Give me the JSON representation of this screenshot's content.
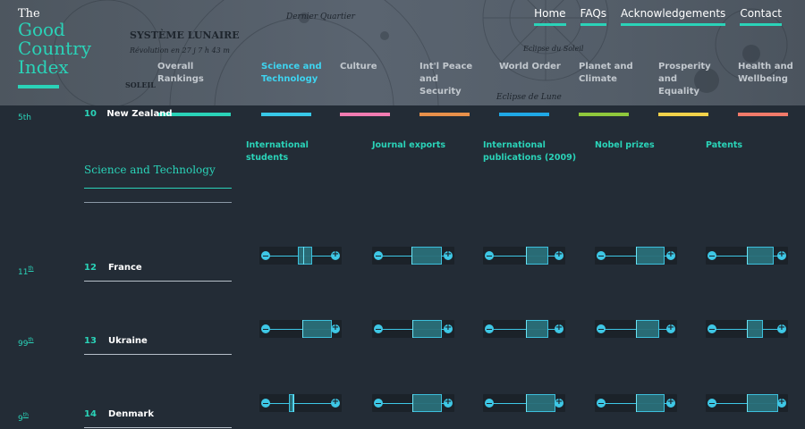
{
  "logo": {
    "small": "The",
    "line1": "Good",
    "line2": "Country",
    "line3": "Index"
  },
  "top_nav": [
    "Home",
    "FAQs",
    "Acknowledgements",
    "Contact"
  ],
  "header_art_text": [
    "SYSTÈME LUNAIRE",
    "Dernier Quartier",
    "Révolution en 27 j 7 h 43 m",
    "SOLEIL",
    "Eclipse du Soleil",
    "Eclipse de Lune"
  ],
  "tabs": [
    {
      "label": "Overall Rankings",
      "color": "#2ad3b8",
      "active": false
    },
    {
      "label": "Science and Technology",
      "color": "#38c8e8",
      "active": true
    },
    {
      "label": "Culture",
      "color": "#f27bb1",
      "active": false
    },
    {
      "label": "Int'l Peace and Security",
      "color": "#e8904a",
      "active": false
    },
    {
      "label": "World Order",
      "color": "#1fa8e6",
      "active": false
    },
    {
      "label": "Planet and Climate",
      "color": "#8fc83c",
      "active": false
    },
    {
      "label": "Prosperity and Equality",
      "color": "#f2d24a",
      "active": false
    },
    {
      "label": "Health and Wellbeing",
      "color": "#f27a6a",
      "active": false
    }
  ],
  "peek_row": {
    "rank": "5th",
    "num": "10",
    "name": "New Zealand"
  },
  "section_title": "Science and Technology",
  "categories": [
    "International students",
    "Journal exports",
    "International publications (2009)",
    "Nobel prizes",
    "Patents"
  ],
  "rows": [
    {
      "num": "12",
      "name": "France",
      "rank": "11",
      "rank_suffix": "th",
      "boxes": [
        {
          "q1": 0.46,
          "median": 0.54,
          "q3": 0.66
        },
        {
          "q1": 0.47,
          "median": 0.47,
          "q3": 0.9
        },
        {
          "q1": 0.52,
          "median": 0.52,
          "q3": 0.84
        },
        {
          "q1": 0.5,
          "median": 0.5,
          "q3": 0.9
        },
        {
          "q1": 0.5,
          "median": 0.5,
          "q3": 0.88
        }
      ]
    },
    {
      "num": "13",
      "name": "Ukraine",
      "rank": "99",
      "rank_suffix": "th",
      "boxes": [
        {
          "q1": 0.52,
          "median": 0.52,
          "q3": 0.94
        },
        {
          "q1": 0.49,
          "median": 0.49,
          "q3": 0.9
        },
        {
          "q1": 0.52,
          "median": 0.52,
          "q3": 0.84
        },
        {
          "q1": 0.5,
          "median": 0.5,
          "q3": 0.82
        },
        {
          "q1": 0.5,
          "median": 0.5,
          "q3": 0.72
        }
      ]
    },
    {
      "num": "14",
      "name": "Denmark",
      "rank": "9",
      "rank_suffix": "th",
      "boxes": [
        {
          "q1": 0.34,
          "median": 0.4,
          "q3": 0.4
        },
        {
          "q1": 0.49,
          "median": 0.49,
          "q3": 0.9
        },
        {
          "q1": 0.52,
          "median": 0.52,
          "q3": 0.94
        },
        {
          "q1": 0.5,
          "median": 0.5,
          "q3": 0.9
        },
        {
          "q1": 0.5,
          "median": 0.5,
          "q3": 0.94
        }
      ]
    }
  ]
}
